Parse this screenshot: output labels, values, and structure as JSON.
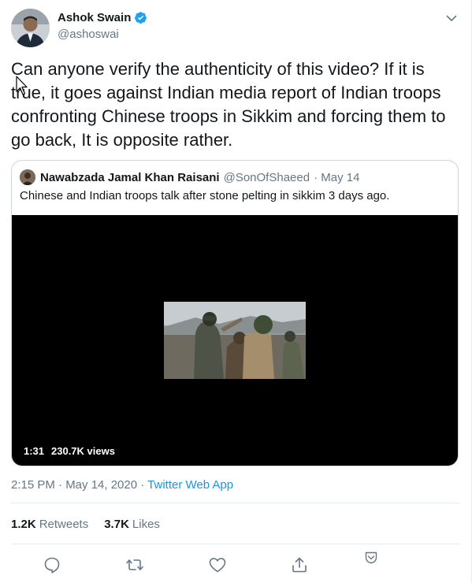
{
  "tweet": {
    "author": {
      "name": "Ashok Swain",
      "handle": "@ashoswai",
      "verified": true
    },
    "text": "Can anyone verify the authenticity of this video? If it is true, it goes against Indian media report of Indian troops confronting Chinese troops in Sikkim and forcing them to go back, It is opposite rather.",
    "quoted": {
      "name": "Nawabzada Jamal Khan Raisani",
      "handle": "@SonOfShaeed",
      "date": "· May 14",
      "text": "Chinese and Indian troops talk after stone pelting in sikkim 3 days ago.",
      "video": {
        "duration": "1:31",
        "views": "230.7K views"
      }
    },
    "timestamp": "2:15 PM · May 14, 2020 · ",
    "source": "Twitter Web App",
    "stats": {
      "retweets_count": "1.2K",
      "retweets_label": "Retweets",
      "likes_count": "3.7K",
      "likes_label": "Likes"
    }
  },
  "icons": {
    "verified": "verified-badge-icon",
    "more": "chevron-down-icon",
    "reply": "reply-icon",
    "retweet": "retweet-icon",
    "like": "heart-icon",
    "share": "share-icon",
    "dropdown": "caret-icon"
  },
  "colors": {
    "accent": "#1da1f2",
    "link": "#1b95e0",
    "secondary_text": "#657786",
    "divider": "#e6ecf0"
  }
}
